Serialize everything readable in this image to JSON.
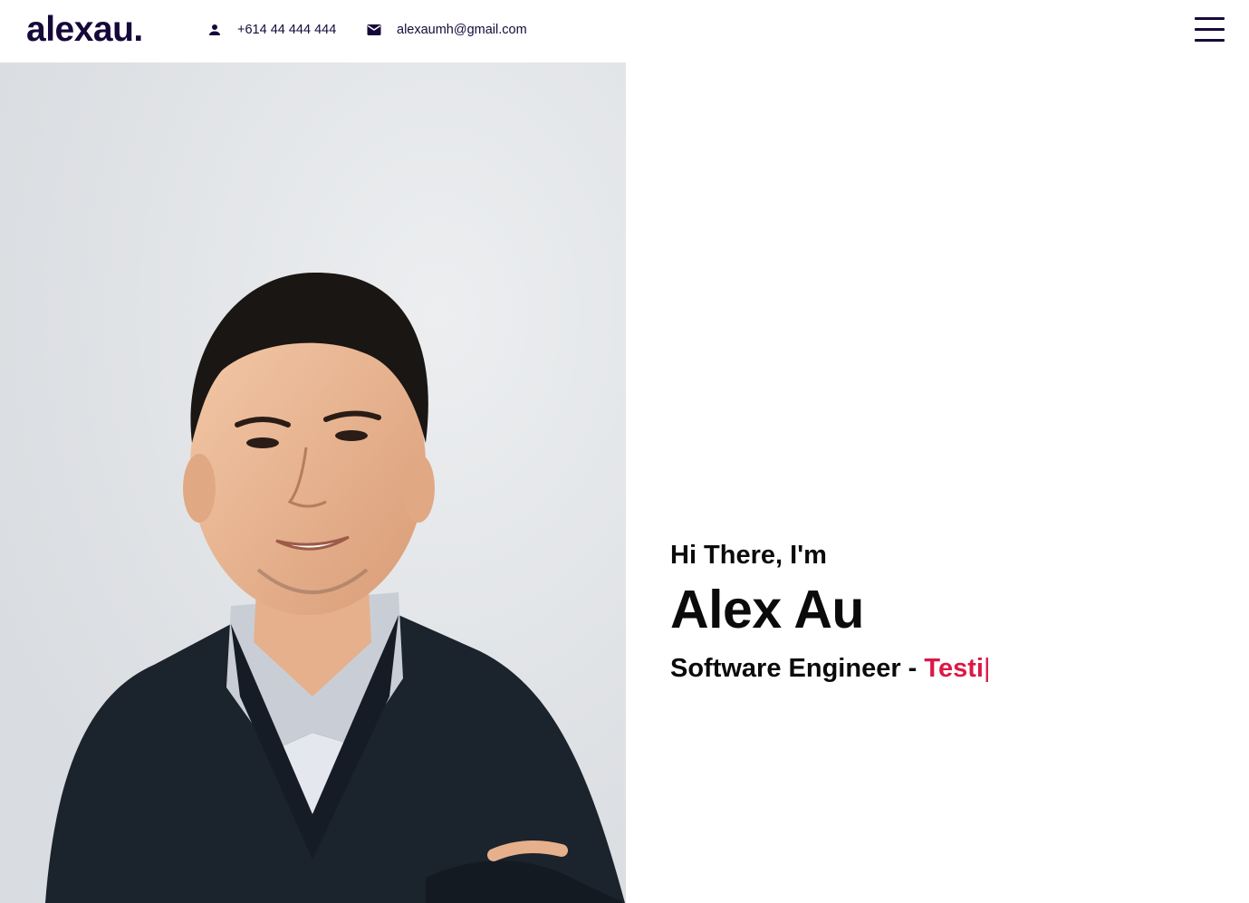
{
  "header": {
    "logo": "alexau.",
    "phone": "+614 44 444 444",
    "email": "alexaumh@gmail.com",
    "phone_icon": "person-icon",
    "email_icon": "mail-icon",
    "menu_icon": "hamburger-menu-icon"
  },
  "hero": {
    "greeting": "Hi There, I'm",
    "name": "Alex Au",
    "role_prefix": "Software Engineer - ",
    "role_typed": "Testi",
    "cursor": "|",
    "photo": "portrait photo of man in dark sweater with collared shirt, arms crossed"
  },
  "colors": {
    "brand": "#16093a",
    "accent": "#dc1846",
    "text": "#0b0b0b"
  }
}
